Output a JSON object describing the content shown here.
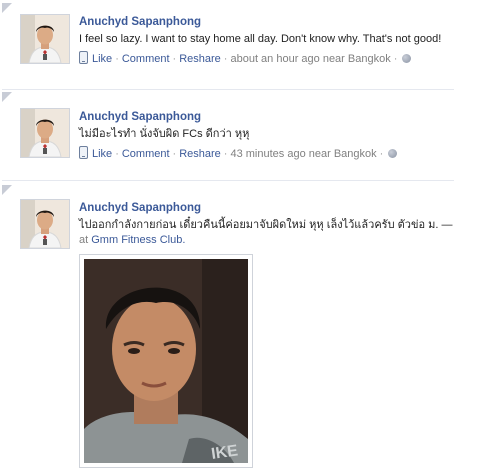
{
  "feed": {
    "stories": [
      {
        "author": "Anuchyd Sapanphong",
        "message": "I feel so lazy. I want to stay home all day. Don't know why. That's not good!",
        "actions": {
          "like": "Like",
          "comment": "Comment",
          "reshare": "Reshare"
        },
        "timestamp": "about an hour ago near Bangkok"
      },
      {
        "author": "Anuchyd Sapanphong",
        "message": "ไม่มีอะไรทำ นั่งจับผิด FCs ดีกว่า หุหุ",
        "actions": {
          "like": "Like",
          "comment": "Comment",
          "reshare": "Reshare"
        },
        "timestamp": "43 minutes ago near Bangkok"
      },
      {
        "author": "Anuchyd Sapanphong",
        "message": "ไปออกกำลังกายก่อน เดี๋ยวคืนนี้ค่อยมาจับผิดใหม่ หุหุ เล็งไว้แล้วครับ ตัวข่อ ม. —",
        "place_prefix": "at",
        "place": "Gmm Fitness Club."
      }
    ]
  },
  "colors": {
    "link": "#3b5998",
    "meta": "#808080",
    "separator": "#e5e8ef"
  },
  "icons": {
    "mobile": "mobile-phone-icon",
    "privacy": "globe-icon"
  }
}
